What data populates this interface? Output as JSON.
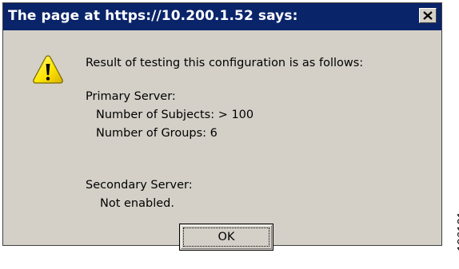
{
  "dialog": {
    "title": "The page at https://10.200.1.52 says:",
    "icon": "warning-icon",
    "message": {
      "intro": "Result of testing this configuration is as follows:",
      "primary_header": "Primary Server:",
      "subjects": "Number of Subjects: > 100",
      "groups": "Number of Groups: 6",
      "secondary_header": "Secondary Server:",
      "secondary_status": "Not enabled."
    },
    "ok_label": "OK",
    "close_icon": "close-icon"
  },
  "figure_id": "196101",
  "colors": {
    "titlebar": "#0a246a",
    "dialog_bg": "#d4d0c8",
    "title_text": "#ffffff",
    "warning_yellow": "#ffe600"
  }
}
